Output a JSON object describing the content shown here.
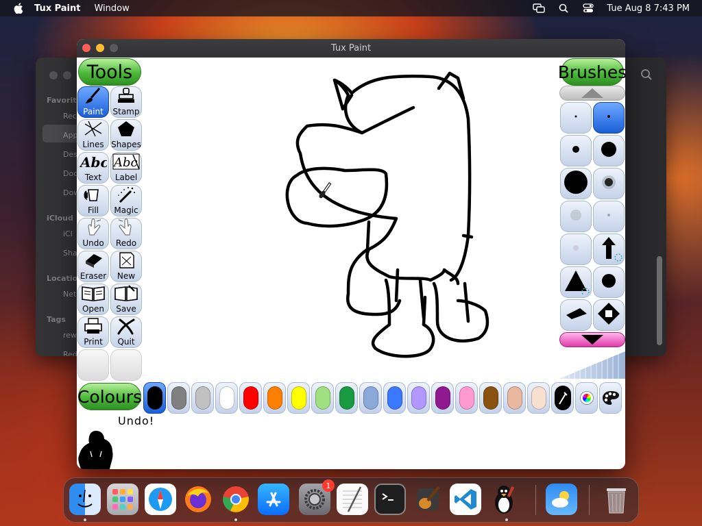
{
  "menubar": {
    "app_name": "Tux Paint",
    "menus": [
      "Window"
    ],
    "datetime": "Tue Aug 8  7:43 PM"
  },
  "finder": {
    "sidebar": [
      {
        "text": "Favorites",
        "header": true
      },
      {
        "text": "Rec",
        "header": false
      },
      {
        "text": "App",
        "header": false
      },
      {
        "text": "Des",
        "header": false
      },
      {
        "text": "Doc",
        "header": false
      },
      {
        "text": "Dow",
        "header": false
      },
      {
        "text": "iCloud",
        "header": true
      },
      {
        "text": "iCl",
        "header": false
      },
      {
        "text": "Sha",
        "header": false
      },
      {
        "text": "Locations",
        "header": true
      },
      {
        "text": "Net",
        "header": false
      },
      {
        "text": "Tags",
        "header": true
      },
      {
        "text": "rew",
        "header": false
      },
      {
        "text": "Red",
        "header": false
      }
    ]
  },
  "window": {
    "title": "Tux Paint"
  },
  "tools": {
    "title": "Tools",
    "items": [
      {
        "label": "Paint",
        "icon": "paint-brush-icon"
      },
      {
        "label": "Stamp",
        "icon": "stamp-icon"
      },
      {
        "label": "Lines",
        "icon": "lines-icon"
      },
      {
        "label": "Shapes",
        "icon": "pentagon-icon"
      },
      {
        "label": "Text",
        "icon": "text-abc-icon"
      },
      {
        "label": "Label",
        "icon": "label-abc-icon"
      },
      {
        "label": "Fill",
        "icon": "paint-bucket-icon"
      },
      {
        "label": "Magic",
        "icon": "magic-wand-icon"
      },
      {
        "label": "Undo",
        "icon": "undo-hand-icon"
      },
      {
        "label": "Redo",
        "icon": "redo-hand-icon"
      },
      {
        "label": "Eraser",
        "icon": "eraser-icon"
      },
      {
        "label": "New",
        "icon": "new-page-icon"
      },
      {
        "label": "Open",
        "icon": "open-book-icon"
      },
      {
        "label": "Save",
        "icon": "save-book-icon"
      },
      {
        "label": "Print",
        "icon": "printer-icon"
      },
      {
        "label": "Quit",
        "icon": "quit-x-icon"
      }
    ],
    "active": "Paint"
  },
  "brushes": {
    "title": "Brushes"
  },
  "colours": {
    "title": "Colours",
    "swatches": [
      "#000000",
      "#808080",
      "#c0c0c0",
      "#ffffff",
      "#ff0000",
      "#ff8000",
      "#ffff00",
      "#a0e080",
      "#1a9a40",
      "#8aa8d8",
      "#3a78ff",
      "#b098ff",
      "#901890",
      "#ff9ad0",
      "#8a5210",
      "#e8b8a0",
      "#f8e0d0"
    ],
    "selected_index": 0,
    "extras": [
      "colour-picker-icon",
      "colour-wheel-icon",
      "colour-mixer-icon"
    ]
  },
  "status": {
    "message": "Undo!"
  },
  "dock": {
    "apps": [
      "finder-icon",
      "launchpad-icon",
      "safari-icon",
      "firefox-icon",
      "chrome-icon",
      "app-store-icon",
      "system-settings-icon",
      "textedit-icon",
      "terminal-icon",
      "garageband-icon",
      "vscode-icon",
      "tux-paint-icon",
      "weather-icon",
      "trash-icon"
    ],
    "settings_badge": "1"
  }
}
